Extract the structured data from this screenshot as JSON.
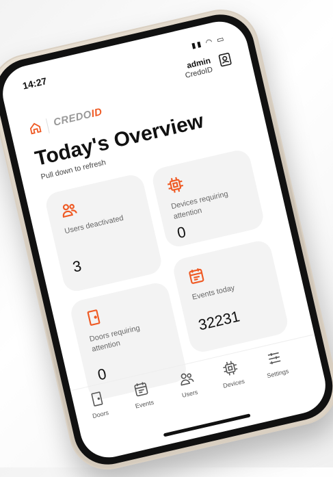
{
  "status": {
    "time": "14:27"
  },
  "header": {
    "user_name": "admin",
    "user_org": "CredoID"
  },
  "logo": {
    "part1": "CREDO",
    "part2": "ID"
  },
  "page": {
    "title": "Today's Overview",
    "subtitle": "Pull down to refresh"
  },
  "cards": {
    "users": {
      "label": "Users deactivated",
      "value": "3"
    },
    "devices": {
      "label": "Devices requiring attention",
      "value": "0"
    },
    "doors": {
      "label": "Doors requiring attention",
      "value": "0"
    },
    "events": {
      "label": "Events today",
      "value": "32231"
    }
  },
  "nav": {
    "doors": "Doors",
    "events": "Events",
    "users": "Users",
    "devices": "Devices",
    "settings": "Settings"
  },
  "colors": {
    "accent": "#ef5a24",
    "card_bg": "#f3f3f3",
    "text": "#111111"
  }
}
